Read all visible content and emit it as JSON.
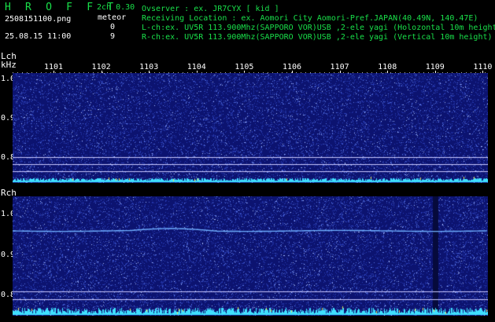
{
  "header": {
    "app_name": "H R O F F T",
    "channel_mode": "2ch 0.30",
    "filename": "2508151100.png",
    "meteor_label": "meteor",
    "timestamp": "25.08.15 11:00",
    "meteor_count_l": "0",
    "meteor_count_r": "9"
  },
  "info": {
    "observer": "Ovserver          : ex. JR7CYX [ kid ]",
    "location": "Receiving Location : ex. Aomori City Aomori-Pref.JAPAN(40.49N, 140.47E)",
    "lch": "L-ch:ex. UV5R 113.900Mhz(SAPPORO VOR)USB ,2-ele yagi (Holozontal 10m height",
    "rch": "R-ch:ex. UV5R 113.900Mhz(SAPPORO VOR)USB ,2-ele yagi (Vertical 10m height)"
  },
  "panels": {
    "lch_label": "Lch",
    "khz_label": "kHz",
    "rch_label": "Rch",
    "lch_yticks": [
      "1.0",
      "0.9",
      "0.8"
    ],
    "rch_yticks": [
      "1.0",
      "0.9",
      "0.8"
    ]
  },
  "time_axis": {
    "labels": [
      "1101",
      "1102",
      "1103",
      "1104",
      "1105",
      "1106",
      "1107",
      "1108",
      "1109",
      "1110"
    ]
  },
  "colors": {
    "text_green": "#19e04a",
    "spectrum_bg": "#0c1370",
    "signal_trace": "#6fb0ff",
    "noise_floor": "#3fe0ff",
    "ref_line": "#c8c8ff"
  }
}
